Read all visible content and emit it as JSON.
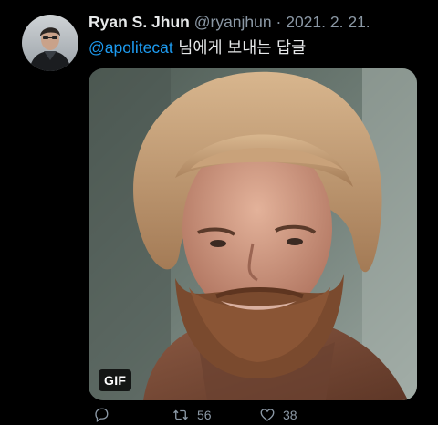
{
  "tweet": {
    "author": {
      "display_name": "Ryan S. Jhun",
      "handle": "@ryanjhun",
      "separator": "·",
      "date": "2021. 2. 21."
    },
    "reply": {
      "mention": "@apolitecat",
      "text": " 님에게 보내는 답글"
    },
    "media": {
      "badge": "GIF"
    },
    "actions": {
      "reply_icon": "reply-icon",
      "retweet_icon": "retweet-icon",
      "retweet_count": "56",
      "like_icon": "heart-icon",
      "like_count": "38"
    }
  },
  "colors": {
    "background": "#000000",
    "text_primary": "#e7e9ea",
    "text_secondary": "#8b98a5",
    "accent": "#1d9bf0"
  }
}
